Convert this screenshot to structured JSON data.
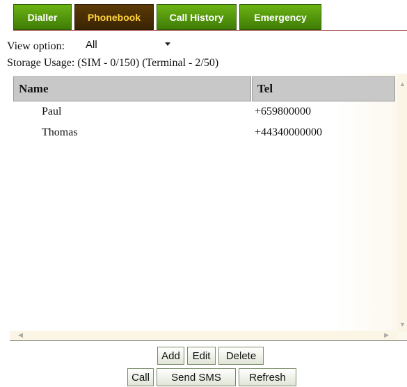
{
  "tabs": [
    {
      "label": "Dialler",
      "active": false
    },
    {
      "label": "Phonebook",
      "active": true
    },
    {
      "label": "Call History",
      "active": false
    },
    {
      "label": "Emergency",
      "active": false
    }
  ],
  "colors": {
    "tab_green": "#4f9a0c",
    "tab_active_bg": "#4a2f05",
    "tab_active_text": "#ffd33a",
    "header_gray": "#c8c8c8"
  },
  "view_option": {
    "label": "View option:",
    "selected": "All"
  },
  "storage_usage": "Storage Usage: (SIM - 0/150)   (Terminal - 2/50)",
  "table": {
    "columns": [
      "Name",
      "Tel"
    ],
    "rows": [
      {
        "name": "Paul",
        "tel": "+659800000"
      },
      {
        "name": "Thomas",
        "tel": "+44340000000"
      }
    ]
  },
  "buttons": {
    "add": "Add",
    "edit": "Edit",
    "delete": "Delete",
    "call": "Call",
    "send_sms": "Send SMS",
    "refresh": "Refresh"
  }
}
